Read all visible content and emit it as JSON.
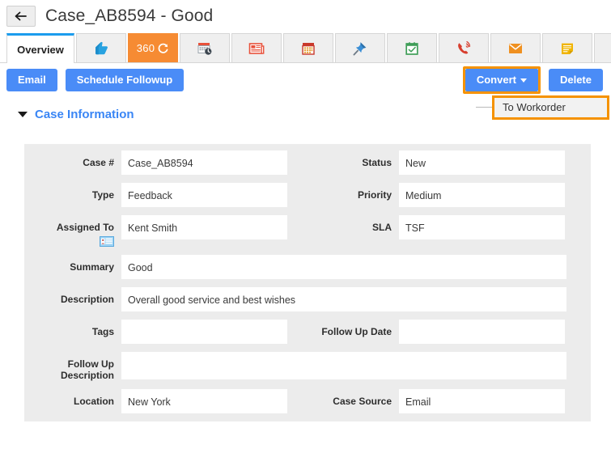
{
  "header": {
    "back_icon": "back-arrow-icon",
    "title": "Case_AB8594 - Good"
  },
  "tabs": [
    {
      "id": "overview",
      "label": "Overview",
      "icon": "",
      "active": true
    },
    {
      "id": "social",
      "label": "",
      "icon": "thumbs-up-icon",
      "active": false
    },
    {
      "id": "threesixty",
      "label": "360",
      "icon": "refresh-360-icon",
      "active": false
    },
    {
      "id": "activity",
      "label": "",
      "icon": "calendar-clock-icon",
      "active": false
    },
    {
      "id": "news",
      "label": "",
      "icon": "newspaper-icon",
      "active": false
    },
    {
      "id": "calendar",
      "label": "",
      "icon": "calendar-icon",
      "active": false
    },
    {
      "id": "pin",
      "label": "",
      "icon": "pushpin-icon",
      "active": false
    },
    {
      "id": "tasks",
      "label": "",
      "icon": "checked-calendar-icon",
      "active": false
    },
    {
      "id": "calls",
      "label": "",
      "icon": "phone-ring-icon",
      "active": false
    },
    {
      "id": "email",
      "label": "",
      "icon": "envelope-icon",
      "active": false
    },
    {
      "id": "notes",
      "label": "",
      "icon": "sticky-note-icon",
      "active": false
    },
    {
      "id": "attach",
      "label": "",
      "icon": "paperclip-icon",
      "active": false
    }
  ],
  "toolbar": {
    "email_label": "Email",
    "schedule_followup_label": "Schedule Followup",
    "convert_label": "Convert",
    "delete_label": "Delete"
  },
  "convert_dropdown": {
    "open": true,
    "items": [
      "To Workorder"
    ],
    "item_0": "To Workorder"
  },
  "section": {
    "title": "Case Information",
    "collapse_icon": "chevron-down-icon"
  },
  "form": {
    "case_number": {
      "label": "Case #",
      "value": "Case_AB8594"
    },
    "status": {
      "label": "Status",
      "value": "New"
    },
    "type": {
      "label": "Type",
      "value": "Feedback"
    },
    "priority": {
      "label": "Priority",
      "value": "Medium"
    },
    "assigned_to": {
      "label": "Assigned To",
      "value": "Kent Smith",
      "icon": "contact-card-icon"
    },
    "sla": {
      "label": "SLA",
      "value": "TSF"
    },
    "summary": {
      "label": "Summary",
      "value": "Good"
    },
    "description": {
      "label": "Description",
      "value": "Overall good service and best wishes"
    },
    "tags": {
      "label": "Tags",
      "value": ""
    },
    "follow_up_date": {
      "label": "Follow Up Date",
      "value": ""
    },
    "follow_up_description": {
      "label_line1": "Follow Up",
      "label_line2": "Description",
      "value": ""
    },
    "location": {
      "label": "Location",
      "value": "New York"
    },
    "case_source": {
      "label": "Case Source",
      "value": "Email"
    }
  },
  "colors": {
    "accent_blue": "#4a8cf7",
    "tab_active_bar": "#1b9ced",
    "highlight_orange": "#f59200",
    "tab_orange": "#f68b33",
    "panel_gray": "#ececec",
    "link_blue": "#3a86f5"
  }
}
